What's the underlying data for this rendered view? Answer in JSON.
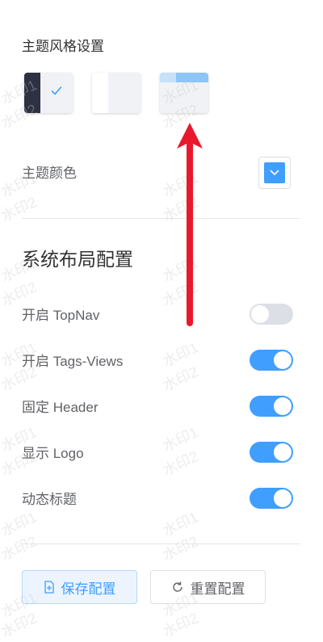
{
  "theme_style": {
    "heading": "主题风格设置",
    "options": [
      "dark",
      "light",
      "top"
    ],
    "selected": "dark"
  },
  "theme_color": {
    "label": "主题颜色",
    "value": "#409eff"
  },
  "layout": {
    "heading": "系统布局配置",
    "items": [
      {
        "label": "开启 TopNav",
        "enabled": false
      },
      {
        "label": "开启 Tags-Views",
        "enabled": true
      },
      {
        "label": "固定 Header",
        "enabled": true
      },
      {
        "label": "显示 Logo",
        "enabled": true
      },
      {
        "label": "动态标题",
        "enabled": true
      }
    ]
  },
  "actions": {
    "save_label": "保存配置",
    "reset_label": "重置配置"
  },
  "watermark": {
    "line1": "水印1",
    "line2": "水印2"
  },
  "colors": {
    "accent": "#409eff",
    "annotation_arrow": "#e8192c"
  }
}
